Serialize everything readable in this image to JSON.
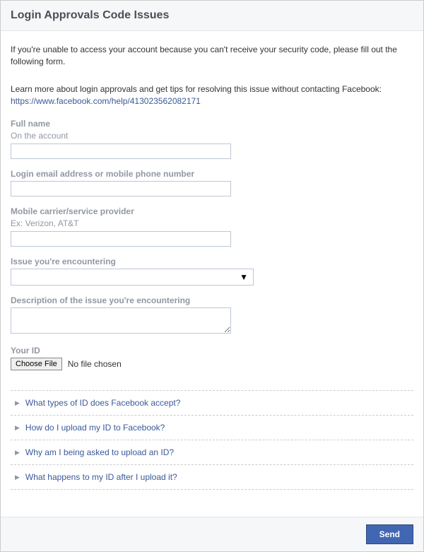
{
  "header": {
    "title": "Login Approvals Code Issues"
  },
  "intro": "If you're unable to access your account because you can't receive your security code, please fill out the following form.",
  "learn_more": "Learn more about login approvals and get tips for resolving this issue without contacting Facebook:",
  "help_link": "https://www.facebook.com/help/413023562082171",
  "fields": {
    "full_name": {
      "label": "Full name",
      "sub": "On the account"
    },
    "login": {
      "label": "Login email address or mobile phone number"
    },
    "carrier": {
      "label": "Mobile carrier/service provider",
      "sub": "Ex: Verizon, AT&T"
    },
    "issue": {
      "label": "Issue you're encountering"
    },
    "description": {
      "label": "Description of the issue you're encountering"
    },
    "id": {
      "label": "Your ID",
      "button": "Choose File",
      "status": "No file chosen"
    }
  },
  "faq": [
    "What types of ID does Facebook accept?",
    "How do I upload my ID to Facebook?",
    "Why am I being asked to upload an ID?",
    "What happens to my ID after I upload it?"
  ],
  "footer": {
    "send": "Send"
  }
}
